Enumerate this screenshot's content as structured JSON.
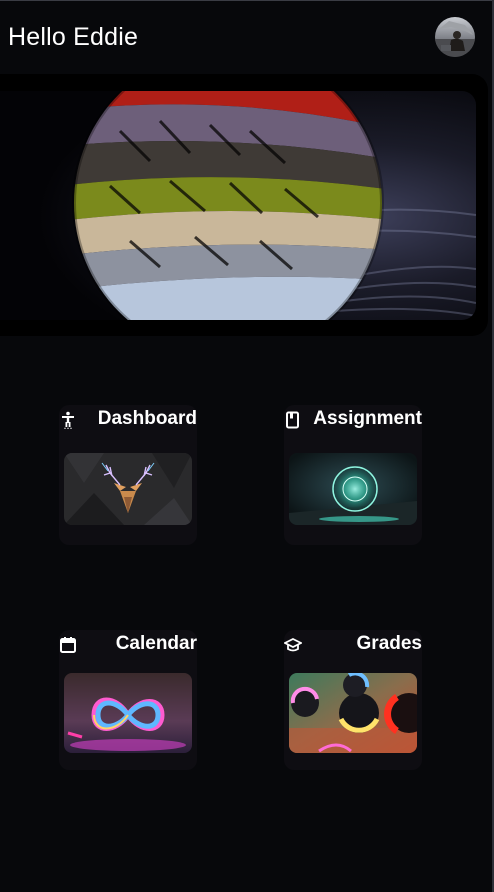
{
  "header": {
    "greeting": "Hello Eddie",
    "avatar_alt": "user avatar"
  },
  "cards": [
    {
      "label": "Dashboard",
      "icon": "accessibility-icon"
    },
    {
      "label": "Assignment",
      "icon": "book-icon"
    },
    {
      "label": "Calendar",
      "icon": "calendar-icon"
    },
    {
      "label": "Grades",
      "icon": "graduation-cap-icon"
    }
  ],
  "colors": {
    "background": "#07080b",
    "card": "#0e0d12",
    "text": "#ffffff"
  }
}
